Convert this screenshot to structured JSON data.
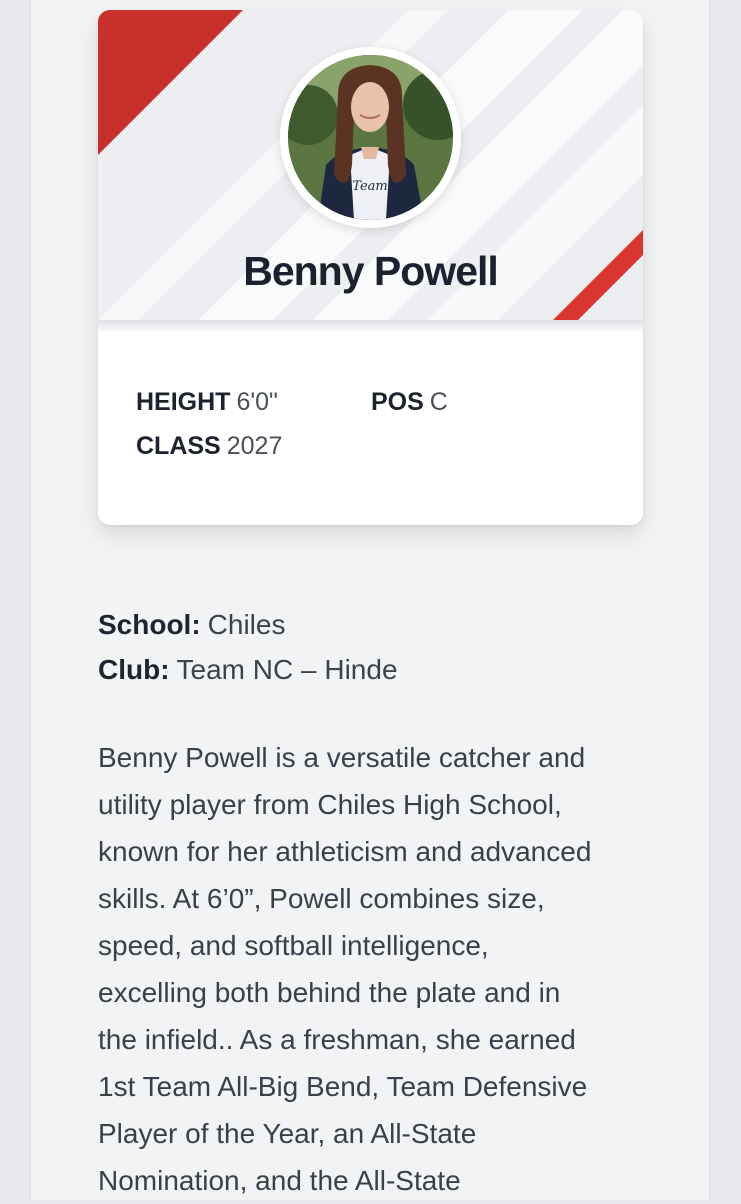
{
  "player": {
    "name": "Benny Powell",
    "photo_alt": "player-portrait",
    "stats": {
      "height_label": "HEIGHT",
      "height_value": "6'0\"",
      "pos_label": "POS",
      "pos_value": "C",
      "class_label": "CLASS",
      "class_value": "2027"
    }
  },
  "info": {
    "school_label": "School:",
    "school_value": "Chiles",
    "club_label": "Club:",
    "club_value": "Team NC – Hinde"
  },
  "bio_lines": [
    "Benny Powell is a versatile catcher and",
    "utility player from Chiles High School,",
    "known for her athleticism and advanced",
    "skills. At 6’0”, Powell combines size,",
    "speed, and softball intelligence,",
    "excelling both behind the plate and in",
    "the infield.. As a freshman, she earned",
    "1st Team All-Big Bend, Team Defensive",
    "Player of the Year, an All-State",
    "Nomination, and the All-State"
  ],
  "colors": {
    "accent_red": "#c8302b",
    "card_header_bg": "#edeef1",
    "page_bg": "#f2f3f5",
    "text_dark": "#1c2130"
  }
}
